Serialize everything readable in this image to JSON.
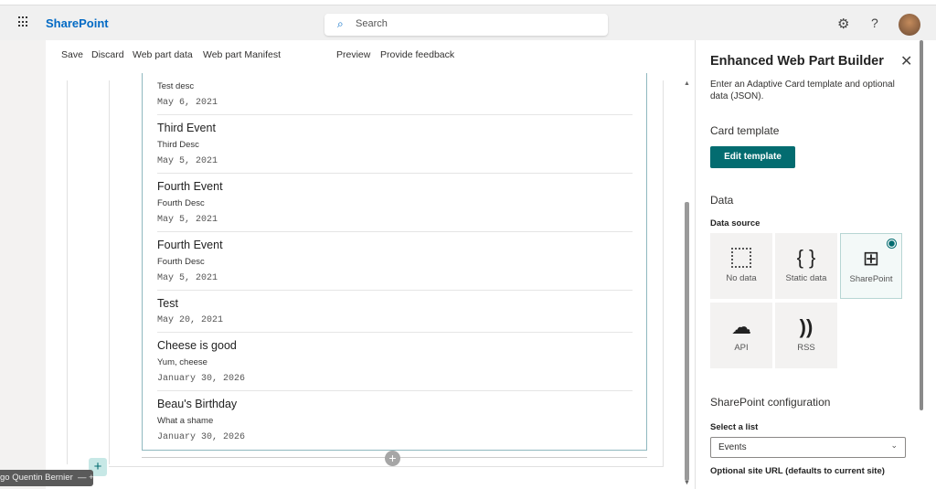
{
  "header": {
    "brand": "SharePoint",
    "search_placeholder": "Search"
  },
  "toolbar": {
    "save": "Save",
    "discard": "Discard",
    "web_part_data": "Web part data",
    "web_part_manifest": "Web part Manifest",
    "preview": "Preview",
    "provide_feedback": "Provide feedback"
  },
  "events": [
    {
      "title": "",
      "desc": "Test desc",
      "date": "May 6, 2021"
    },
    {
      "title": "Third Event",
      "desc": "Third Desc",
      "date": "May 5, 2021"
    },
    {
      "title": "Fourth Event",
      "desc": "Fourth Desc",
      "date": "May 5, 2021"
    },
    {
      "title": "Fourth Event",
      "desc": "Fourth Desc",
      "date": "May 5, 2021"
    },
    {
      "title": "Test",
      "desc": "",
      "date": "May 20, 2021"
    },
    {
      "title": "Cheese is good",
      "desc": "Yum, cheese",
      "date": "January 30, 2026"
    },
    {
      "title": "Beau's Birthday",
      "desc": "What a shame",
      "date": "January 30, 2026"
    }
  ],
  "presenter": "go Quentin Bernier",
  "panel": {
    "title": "Enhanced Web Part Builder",
    "description": "Enter an Adaptive Card template and optional data (JSON).",
    "card_template_heading": "Card template",
    "edit_template": "Edit template",
    "data_heading": "Data",
    "data_source_label": "Data source",
    "sources": [
      {
        "label": "No data",
        "icon": "dotted-square"
      },
      {
        "label": "Static data",
        "icon": "braces"
      },
      {
        "label": "SharePoint",
        "icon": "table",
        "selected": true
      },
      {
        "label": "API",
        "icon": "cloud-link"
      },
      {
        "label": "RSS",
        "icon": "rss"
      }
    ],
    "sp_config_heading": "SharePoint configuration",
    "select_list_label": "Select a list",
    "select_list_value": "Events",
    "site_url_label": "Optional site URL (defaults to current site)"
  },
  "colors": {
    "accent": "#036c70",
    "brand": "#036ac4"
  }
}
